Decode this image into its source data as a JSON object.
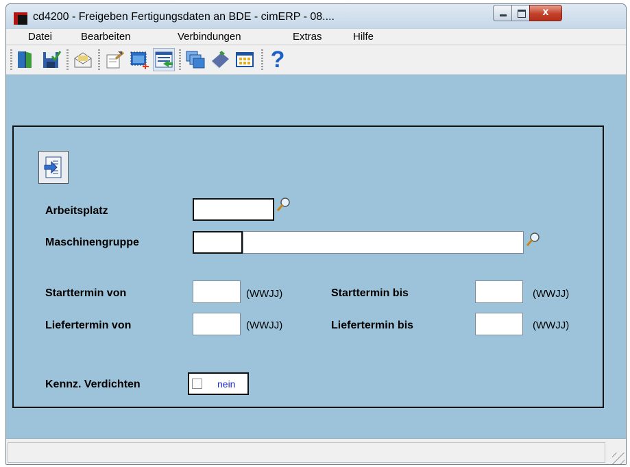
{
  "window": {
    "title": "cd4200 - Freigeben Fertigungsdaten an BDE - cimERP - 08....",
    "close_glyph": "x"
  },
  "menu": {
    "items": [
      {
        "label": "Datei"
      },
      {
        "label": "Bearbeiten"
      },
      {
        "label": "Verbindungen"
      },
      {
        "label": "Extras"
      },
      {
        "label": "Hilfe"
      }
    ]
  },
  "toolbar": {
    "icons": [
      "exit-door-icon",
      "save-icon",
      "mail-icon",
      "edit-pen-icon",
      "new-record-icon",
      "transfer-list-icon",
      "windows-icon",
      "book-icon",
      "table-grid-icon",
      "help-icon"
    ],
    "help_glyph": "?"
  },
  "form": {
    "arbeitsplatz_label": "Arbeitsplatz",
    "maschinengruppe_label": "Maschinengruppe",
    "starttermin_von_label": "Starttermin von",
    "starttermin_bis_label": "Starttermin bis",
    "liefertermin_von_label": "Liefertermin von",
    "liefertermin_bis_label": "Liefertermin bis",
    "unit_label": "(WWJJ)",
    "verdichten_label": "Kennz. Verdichten",
    "verdichten_value": "nein"
  },
  "colors": {
    "panel_bg": "#9cc3d9",
    "window_frame": "#bcd2e4",
    "checkbox_text": "#1a2bcf"
  }
}
